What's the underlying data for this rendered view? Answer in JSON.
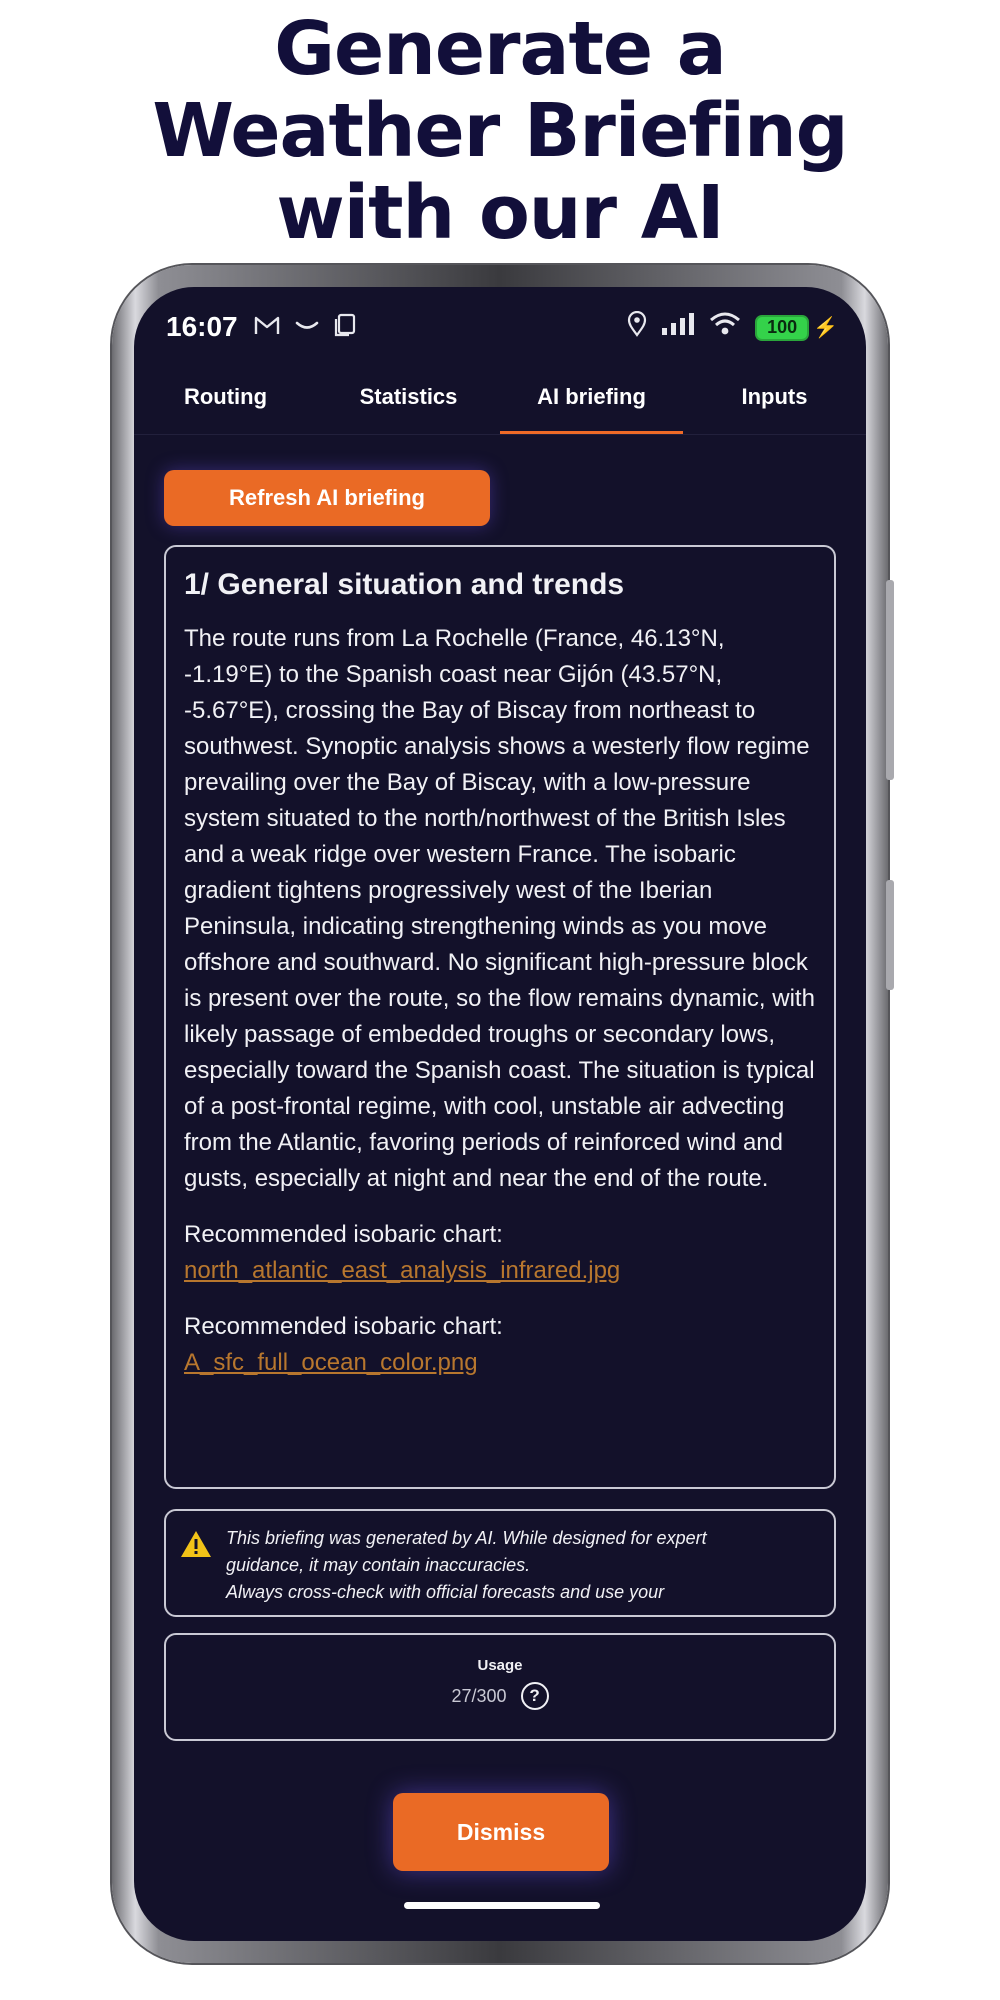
{
  "headline": {
    "line1": "Generate a",
    "line2": "Weather Briefing",
    "line3": "with our AI"
  },
  "status_bar": {
    "time": "16:07",
    "battery": "100",
    "icons_left": [
      "gmail-icon",
      "smile-icon",
      "copy-icon"
    ],
    "icons_right": [
      "location-icon",
      "signal-icon",
      "wifi-icon",
      "battery-icon",
      "charging-icon"
    ]
  },
  "tabs": [
    {
      "label": "Routing"
    },
    {
      "label": "Statistics"
    },
    {
      "label": "AI briefing",
      "active": true
    },
    {
      "label": "Inputs"
    }
  ],
  "refresh_button": "Refresh AI briefing",
  "briefing": {
    "title": "1/ General situation and trends",
    "body": "The route runs from La Rochelle (France, 46.13°N, -1.19°E) to the Spanish coast near Gijón (43.57°N, -5.67°E), crossing the Bay of Biscay from northeast to southwest. Synoptic analysis shows a westerly flow regime prevailing over the Bay of Biscay, with a low-pressure system situated to the north/northwest of the British Isles and a weak ridge over western France. The isobaric gradient tightens progressively west of the Iberian Peninsula, indicating strengthening winds as you move offshore and southward. No significant high-pressure block is present over the route, so the flow remains dynamic, with likely passage of embedded troughs or secondary lows, especially toward the Spanish coast. The situation is typical of a post-frontal regime, with cool, unstable air advecting from the Atlantic, favoring periods of reinforced wind and gusts, especially at night and near the end of the route.",
    "charts": [
      {
        "label": "Recommended isobaric chart:",
        "link": "north_atlantic_east_analysis_infrared.jpg"
      },
      {
        "label": "Recommended isobaric chart:",
        "link": "A_sfc_full_ocean_color.png"
      }
    ]
  },
  "disclaimer": {
    "line1": "This briefing was generated by AI. While designed for expert",
    "line2": "guidance, it may contain inaccuracies.",
    "line3": "Always cross-check with official forecasts and use your"
  },
  "usage": {
    "title": "Usage",
    "value": "27/300",
    "help": "?"
  },
  "dismiss_button": "Dismiss",
  "colors": {
    "accent": "#ea6a25",
    "background": "#13112a",
    "headline": "#120f3a",
    "link": "#b8772e",
    "battery": "#34d24a"
  }
}
